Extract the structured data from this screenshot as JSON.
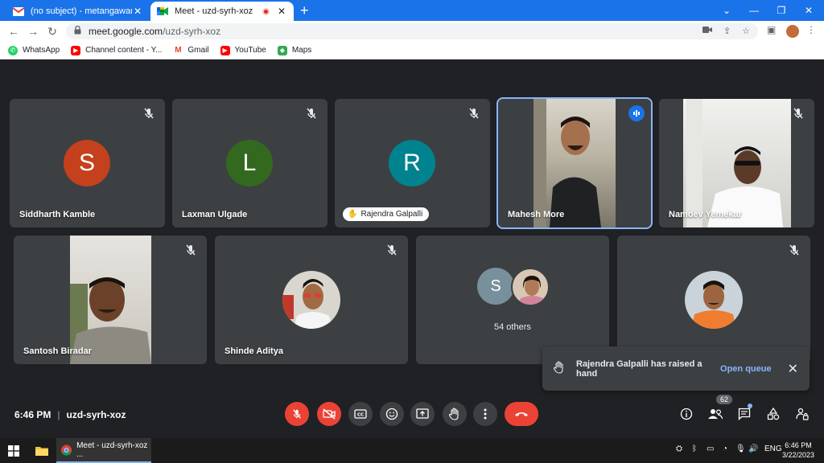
{
  "browser": {
    "tabs": [
      {
        "title": "(no subject) - metangawar@gm...",
        "active": false
      },
      {
        "title": "Meet - uzd-syrh-xoz",
        "active": true
      }
    ],
    "url_host": "meet.google.com",
    "url_path": "/uzd-syrh-xoz",
    "bookmarks": [
      "WhatsApp",
      "Channel content - Y...",
      "Gmail",
      "YouTube",
      "Maps"
    ]
  },
  "tiles": {
    "row1": [
      {
        "name": "Siddharth Kamble",
        "letter": "S",
        "color": "#c5401c"
      },
      {
        "name": "Laxman Ulgade",
        "letter": "L",
        "color": "#33691e"
      },
      {
        "name": "Rajendra Galpalli",
        "letter": "R",
        "color": "#00838f"
      },
      {
        "name": "Mahesh More"
      },
      {
        "name": "Namdev Yemekar"
      }
    ],
    "row2": [
      {
        "name": "Santosh Biradar"
      },
      {
        "name": "Shinde Aditya"
      },
      {
        "others_letter": "S",
        "others": "54 others"
      },
      {}
    ]
  },
  "toast": {
    "message": "Rajendra Galpalli has raised a hand",
    "action": "Open queue"
  },
  "meeting": {
    "time": "6:46 PM",
    "separator": "|",
    "code": "uzd-syrh-xoz",
    "people_count": "62"
  },
  "taskbar": {
    "chrome_label": "Meet - uzd-syrh-xoz ...",
    "lang": "ENG",
    "time": "6:46 PM",
    "date": "3/22/2023"
  },
  "colors": {
    "accent": "#1a73e8",
    "danger": "#ea4335",
    "tile_bg": "#3c4043",
    "stage_bg": "#202124"
  }
}
